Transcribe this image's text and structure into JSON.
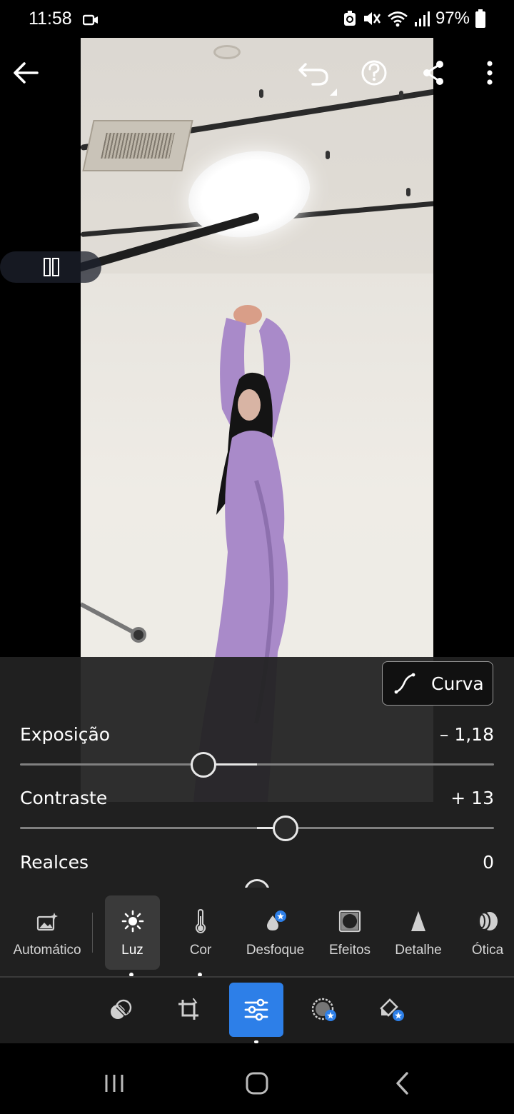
{
  "status_bar": {
    "time": "11:58",
    "battery": "97%",
    "icons": [
      "video-camera-icon",
      "recycle-icon",
      "mute-icon",
      "wifi-icon",
      "signal-icon",
      "battery-icon"
    ]
  },
  "toolbar": {
    "back_icon": "arrow-left-icon",
    "undo_icon": "undo-icon",
    "help_icon": "help-icon",
    "share_icon": "share-icon",
    "more_icon": "more-vertical-icon"
  },
  "panel": {
    "curva_label": "Curva",
    "sliders": [
      {
        "label": "Exposição",
        "value": "– 1,18",
        "fraction": 0.387
      },
      {
        "label": "Contraste",
        "value": "+ 13",
        "fraction": 0.56
      },
      {
        "label": "Realces",
        "value": "0",
        "fraction": 0.5
      }
    ]
  },
  "tabs": [
    {
      "label": "Automático",
      "icon": "auto-enhance-icon",
      "active": false
    },
    {
      "label": "Luz",
      "icon": "sun-icon",
      "active": true
    },
    {
      "label": "Cor",
      "icon": "thermometer-icon",
      "active": false
    },
    {
      "label": "Desfoque",
      "icon": "drop-blur-icon",
      "active": false
    },
    {
      "label": "Efeitos",
      "icon": "vignette-icon",
      "active": false
    },
    {
      "label": "Detalhe",
      "icon": "triangle-detail-icon",
      "active": false
    },
    {
      "label": "Ótica",
      "icon": "lens-icon",
      "active": false
    }
  ],
  "modes": [
    {
      "name": "presets-icon",
      "active": false
    },
    {
      "name": "crop-icon",
      "active": false
    },
    {
      "name": "adjust-sliders-icon",
      "active": true
    },
    {
      "name": "masking-icon",
      "active": false
    },
    {
      "name": "healing-icon",
      "active": false
    }
  ],
  "colors": {
    "accent": "#2d7fe8",
    "panel": "#222222",
    "dress": "#a98ac9"
  }
}
